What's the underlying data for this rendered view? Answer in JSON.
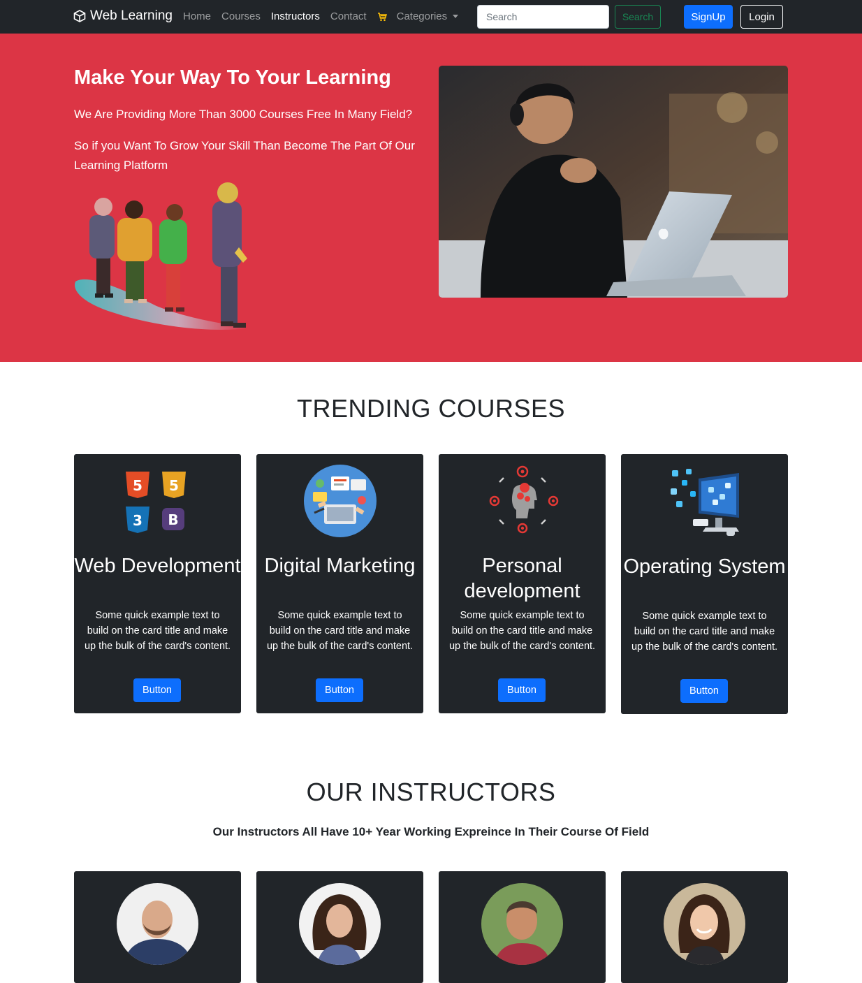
{
  "navbar": {
    "brand": "Web Learning",
    "links": [
      "Home",
      "Courses",
      "Instructors",
      "Contact"
    ],
    "active_link": "Instructors",
    "dropdown_label": "Categories",
    "search_placeholder": "Search",
    "search_button": "Search",
    "signup_button": "SignUp",
    "login_button": "Login"
  },
  "hero": {
    "title": "Make Your Way To Your Learning",
    "paragraph1": "We Are Providing More Than 3000 Courses Free In Many Field?",
    "paragraph2": "So if you Want To Grow Your Skill Than Become The Part Of Our Learning Platform"
  },
  "trending": {
    "title": "TRENDING COURSES",
    "cards": [
      {
        "title": "Web Development",
        "text": "Some quick example text to build on the card title and make up the bulk of the card's content.",
        "button": "Button",
        "icon": "web-tech-logos-icon"
      },
      {
        "title": "Digital Marketing",
        "text": "Some quick example text to build on the card title and make up the bulk of the card's content.",
        "button": "Button",
        "icon": "marketing-desk-icon"
      },
      {
        "title": "Personal development",
        "text": "Some quick example text to build on the card title and make up the bulk of the card's content.",
        "button": "Button",
        "icon": "head-gears-icon"
      },
      {
        "title": "Operating System",
        "text": "Some quick example text to build on the card title and make up the bulk of the card's content.",
        "button": "Button",
        "icon": "computer-apps-icon"
      }
    ]
  },
  "instructors": {
    "title": "OUR INSTRUCTORS",
    "subtitle": "Our Instructors All Have 10+ Year Working Expreince In Their Course Of Field"
  },
  "colors": {
    "navbar": "#212529",
    "hero": "#dc3545",
    "card": "#212529",
    "primary": "#0d6efd",
    "success": "#198754"
  }
}
